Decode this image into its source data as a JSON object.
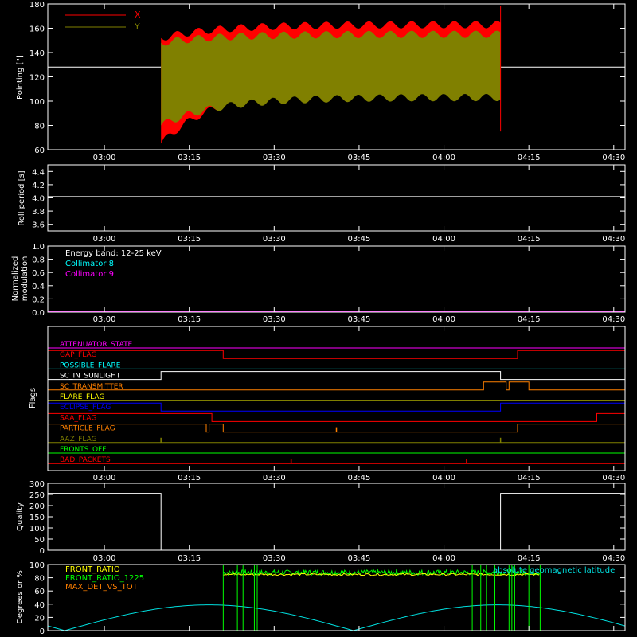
{
  "colors": {
    "background": "#000000",
    "axis": "#ffffff",
    "x_series": "#ff0000",
    "y_series": "#808000",
    "collimator8": "#00ffff",
    "collimator9": "#ff00ff",
    "front_ratio": "#ffff00",
    "front_ratio_1225": "#00ff00",
    "max_det_vs_tot": "#ff8000",
    "geomag": "#00e0e0"
  },
  "time_axis": {
    "ticks": [
      "03:00",
      "03:15",
      "03:30",
      "03:45",
      "04:00",
      "04:15",
      "04:30"
    ],
    "range_minutes": [
      -10,
      92
    ]
  },
  "chart_data": [
    {
      "name": "pointing",
      "type": "area",
      "ylabel": "Pointing [\"]",
      "ylim": [
        60,
        180
      ],
      "yticks": [
        "60",
        "80",
        "100",
        "120",
        "140",
        "160",
        "180"
      ],
      "legend": [
        "X",
        "Y"
      ],
      "legend_position": "top-left",
      "data_interval_minutes": [
        10,
        70
      ],
      "reference_line": 128,
      "x_series": {
        "start_range": [
          65,
          152
        ],
        "end_range": [
          112,
          163
        ]
      },
      "y_series": {
        "start_range": [
          80,
          148
        ],
        "end_range": [
          103,
          155
        ]
      }
    },
    {
      "name": "roll-period",
      "type": "line",
      "ylabel": "Roll period [s]",
      "ylim": [
        3.5,
        4.5
      ],
      "yticks": [
        "3.6",
        "3.8",
        "4.0",
        "4.2",
        "4.4"
      ],
      "value": 4.02
    },
    {
      "name": "modulation",
      "type": "line",
      "ylabel": "Normalized modulation",
      "ylim": [
        0,
        1
      ],
      "yticks": [
        "0.0",
        "0.2",
        "0.4",
        "0.6",
        "0.8",
        "1.0"
      ],
      "legend": [
        "Energy band: 12-25 keV",
        "Collimator 8",
        "Collimator 9"
      ],
      "value": 0
    },
    {
      "name": "flags",
      "type": "line",
      "ylabel": "Flags",
      "flags": [
        {
          "label": "ATTENUATOR_STATE",
          "color": "#ff00ff",
          "segments": [
            [
              -10,
              92,
              0
            ]
          ]
        },
        {
          "label": "GAP_FLAG",
          "color": "#ff0000",
          "segments": [
            [
              -10,
              21,
              1
            ],
            [
              21,
              73,
              0
            ],
            [
              73,
              92,
              1
            ]
          ]
        },
        {
          "label": "POSSIBLE_FLARE",
          "color": "#00ffff",
          "segments": [
            [
              -10,
              92,
              0
            ]
          ]
        },
        {
          "label": "SC_IN_SUNLIGHT",
          "color": "#ffffff",
          "segments": [
            [
              -10,
              10,
              0
            ],
            [
              10,
              70,
              1
            ],
            [
              70,
              92,
              0
            ]
          ]
        },
        {
          "label": "SC_TRANSMITTER",
          "color": "#ff8000",
          "segments": [
            [
              -10,
              67,
              0
            ],
            [
              67,
              71,
              1
            ],
            [
              71,
              71.5,
              0
            ],
            [
              71.5,
              75,
              1
            ],
            [
              75,
              92,
              0
            ]
          ]
        },
        {
          "label": "FLARE_FLAG",
          "color": "#ffff00",
          "segments": [
            [
              -10,
              92,
              0
            ]
          ]
        },
        {
          "label": "ECLIPSE_FLAG",
          "color": "#0000ff",
          "segments": [
            [
              -10,
              10,
              1
            ],
            [
              10,
              70,
              0
            ],
            [
              70,
              92,
              1
            ]
          ]
        },
        {
          "label": "SAA_FLAG",
          "color": "#ff0000",
          "segments": [
            [
              -10,
              19,
              1
            ],
            [
              19,
              87,
              0
            ],
            [
              87,
              92,
              1
            ]
          ]
        },
        {
          "label": "PARTICLE_FLAG",
          "color": "#ff8000",
          "segments": [
            [
              -10,
              18,
              1
            ],
            [
              18,
              18.5,
              0
            ],
            [
              18.5,
              21,
              1
            ],
            [
              21,
              73,
              0
            ],
            [
              73,
              92,
              1
            ]
          ],
          "spikes": [
            41
          ]
        },
        {
          "label": "AAZ_FLAG",
          "color": "#808000",
          "segments": [
            [
              -10,
              92,
              0
            ]
          ],
          "spikes": [
            10,
            70
          ]
        },
        {
          "label": "FRONTS_OFF",
          "color": "#00ff00",
          "segments": [
            [
              -10,
              92,
              0
            ]
          ]
        },
        {
          "label": "BAD_PACKETS",
          "color": "#ff0000",
          "segments": [
            [
              -10,
              92,
              0
            ]
          ],
          "spikes": [
            33,
            64
          ]
        }
      ]
    },
    {
      "name": "quality",
      "type": "line",
      "ylabel": "Quality",
      "ylim": [
        0,
        300
      ],
      "yticks": [
        "0",
        "50",
        "100",
        "150",
        "200",
        "250",
        "300"
      ],
      "segments": [
        [
          -10,
          10,
          255
        ],
        [
          10,
          70,
          0
        ],
        [
          70,
          92,
          255
        ]
      ]
    },
    {
      "name": "ratios",
      "type": "line",
      "ylabel": "Degrees or %",
      "ylim": [
        0,
        100
      ],
      "yticks": [
        "0",
        "20",
        "40",
        "60",
        "80",
        "100"
      ],
      "legend": [
        "FRONT_RATIO",
        "FRONT_RATIO_1225",
        "MAX_DET_VS_TOT"
      ],
      "annotation": "absolute geomagnetic latitude",
      "ratio_interval_minutes": [
        21,
        77
      ],
      "front_ratio_level": 85,
      "front_ratio_1225_level": 88,
      "geomag_peaks_minutes": [
        21,
        72
      ],
      "geomag_zeros_minutes": [
        -7,
        46
      ],
      "geomag_max": 39
    }
  ]
}
